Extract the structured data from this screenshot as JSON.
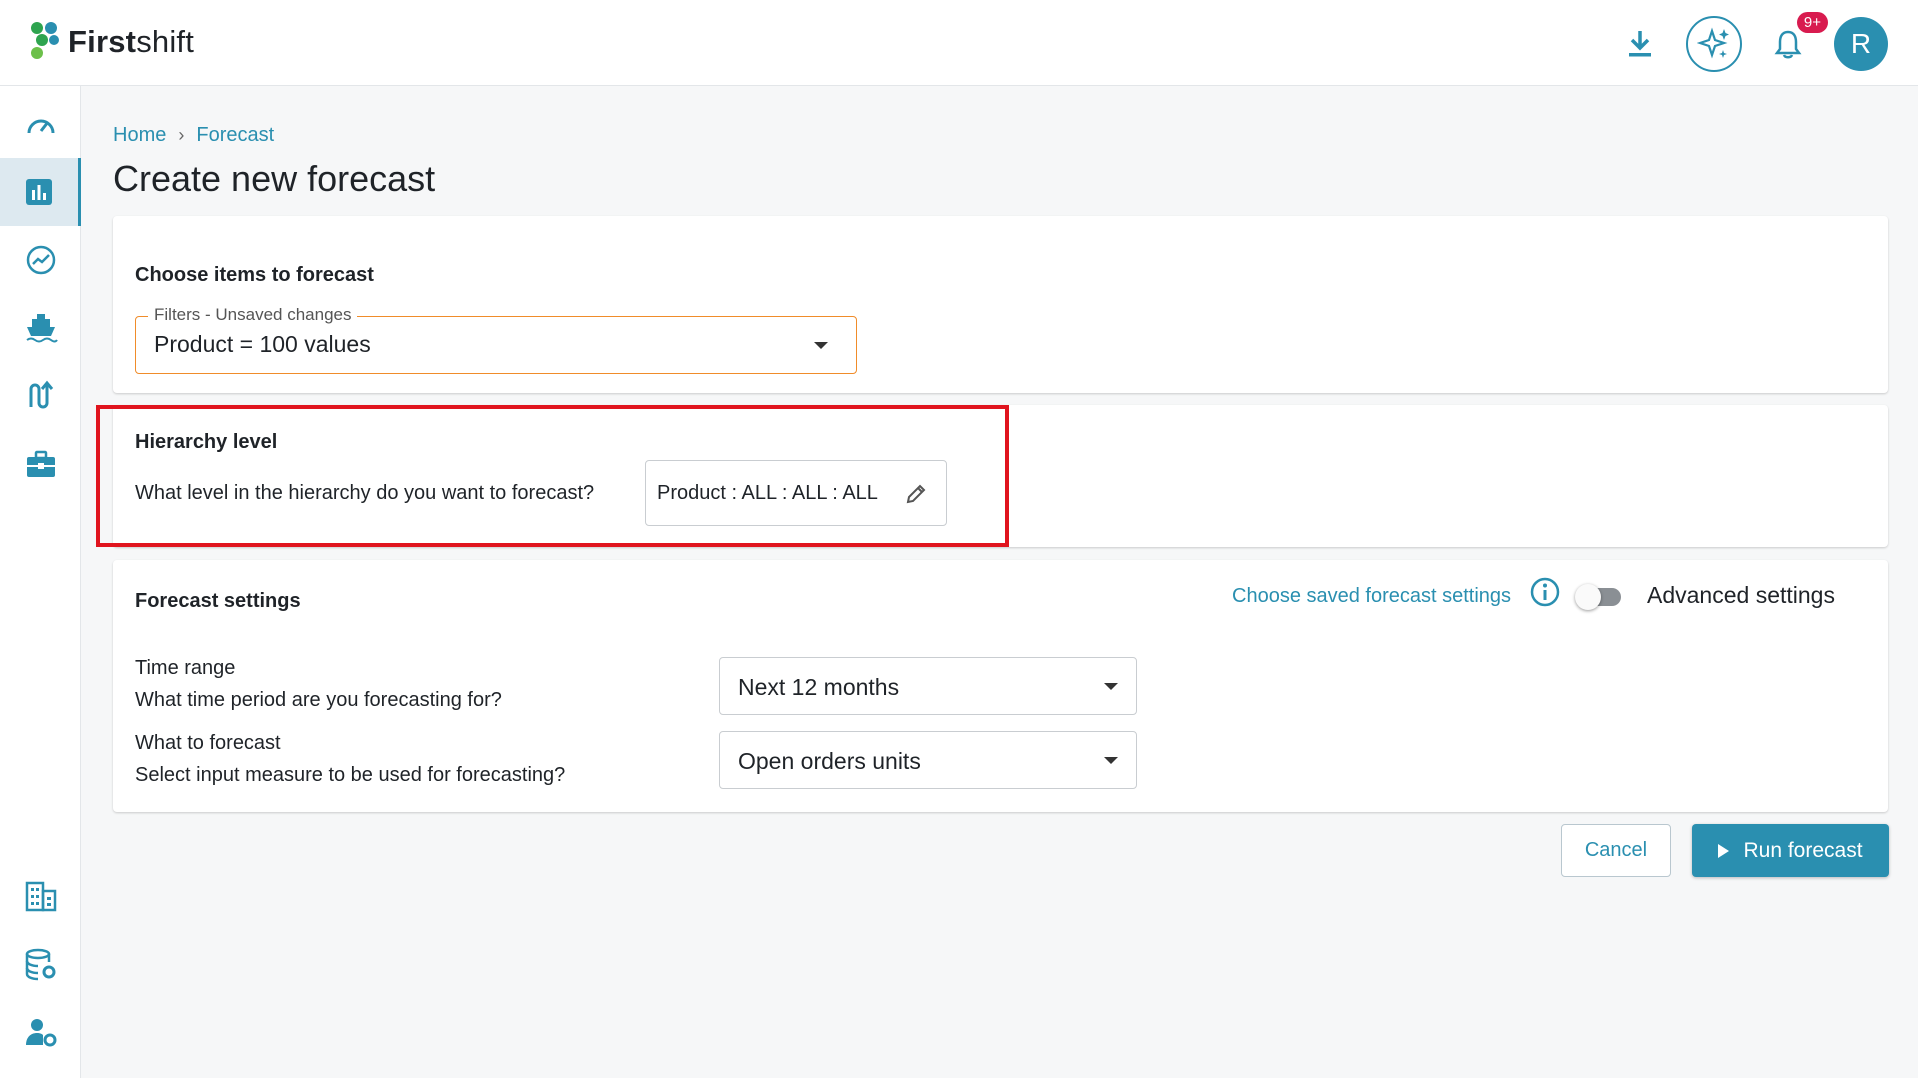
{
  "app": {
    "logo_bold": "First",
    "logo_light": "shift",
    "notification_badge": "9+",
    "avatar_initial": "R"
  },
  "sidebar": {
    "items": [
      {
        "icon": "speedometer-icon",
        "active": false
      },
      {
        "icon": "bar-chart-icon",
        "active": true
      },
      {
        "icon": "trending-up-icon",
        "active": false
      },
      {
        "icon": "ship-icon",
        "active": false
      },
      {
        "icon": "swap-arrows-icon",
        "active": false
      },
      {
        "icon": "briefcase-icon",
        "active": false
      },
      {
        "icon": "building-icon",
        "active": false
      },
      {
        "icon": "database-settings-icon",
        "active": false
      },
      {
        "icon": "user-settings-icon",
        "active": false
      }
    ]
  },
  "breadcrumb": {
    "home": "Home",
    "separator": "›",
    "current": "Forecast"
  },
  "page": {
    "title": "Create new forecast"
  },
  "items_card": {
    "title": "Choose items to forecast",
    "filter_legend": "Filters - Unsaved changes",
    "filter_value": "Product = 100 values"
  },
  "hierarchy_card": {
    "title": "Hierarchy level",
    "question": "What level in the hierarchy do you want to forecast?",
    "value": "Product : ALL : ALL : ALL"
  },
  "settings_card": {
    "title": "Forecast settings",
    "saved_link": "Choose saved forecast settings",
    "advanced_label": "Advanced settings",
    "advanced_enabled": false,
    "time_range_label": "Time range",
    "time_range_question": "What time period are you forecasting for?",
    "time_range_value": "Next 12 months",
    "measure_label": "What to forecast",
    "measure_question": "Select input measure to be used for forecasting?",
    "measure_value": "Open orders units"
  },
  "actions": {
    "cancel": "Cancel",
    "run": "Run forecast"
  },
  "colors": {
    "accent": "#2a8fb0",
    "highlight": "#e0141e",
    "filter_border": "#f08c2a",
    "badge": "#d81b4f"
  }
}
